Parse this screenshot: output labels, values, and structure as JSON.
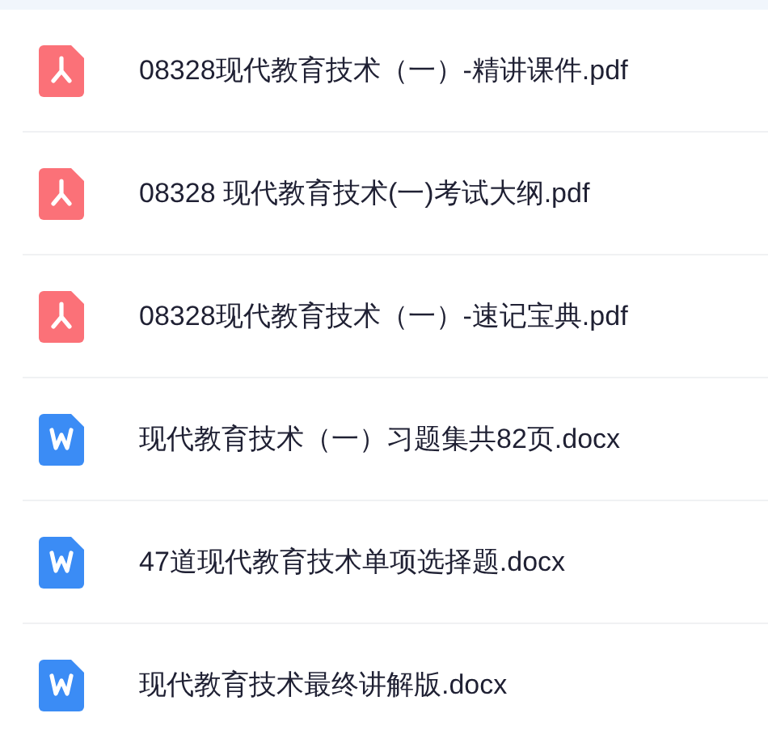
{
  "files": [
    {
      "kind": "pdf",
      "name": "08328现代教育技术（一）-精讲课件.pdf"
    },
    {
      "kind": "pdf",
      "name": "08328 现代教育技术(一)考试大纲.pdf"
    },
    {
      "kind": "pdf",
      "name": "08328现代教育技术（一）-速记宝典.pdf"
    },
    {
      "kind": "doc",
      "name": "现代教育技术（一）习题集共82页.docx"
    },
    {
      "kind": "doc",
      "name": "47道现代教育技术单项选择题.docx"
    },
    {
      "kind": "doc",
      "name": "现代教育技术最终讲解版.docx"
    }
  ]
}
